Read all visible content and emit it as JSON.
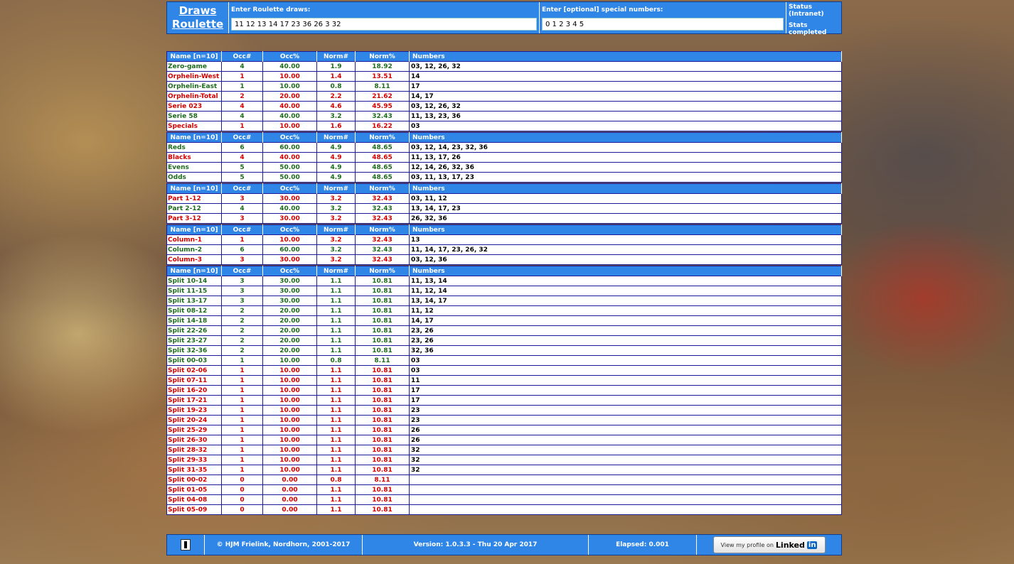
{
  "app": {
    "title_line1": "Draws",
    "title_line2": "Roulette"
  },
  "draws": {
    "label": "Enter Roulette draws:",
    "value": "11 12 13 14 17 23 36 26 3 32"
  },
  "specials": {
    "label": "Enter [optional] special numbers:",
    "value": "0 1 2 3 4 5"
  },
  "status": {
    "label": "Status (Intranet)",
    "value": "Stats completed"
  },
  "columns": {
    "name": "Name [n=10]",
    "occ": "Occ#",
    "occp": "Occ%",
    "normn": "Norm#",
    "normp": "Norm%",
    "numbers": "Numbers"
  },
  "colors": {
    "header_blue": "#2f86e6",
    "good_green": "#1d6b1d",
    "bad_red": "#d40000"
  },
  "groups": [
    [
      {
        "name": "Zero-game",
        "occ": "4",
        "occp": "40.00",
        "normn": "1.9",
        "normp": "18.92",
        "numbers": "03, 12, 26, 32",
        "c": "g"
      },
      {
        "name": "Orphelin-West",
        "occ": "1",
        "occp": "10.00",
        "normn": "1.4",
        "normp": "13.51",
        "numbers": "14",
        "c": "r"
      },
      {
        "name": "Orphelin-East",
        "occ": "1",
        "occp": "10.00",
        "normn": "0.8",
        "normp": "8.11",
        "numbers": "17",
        "c": "g"
      },
      {
        "name": "Orphelin-Total",
        "occ": "2",
        "occp": "20.00",
        "normn": "2.2",
        "normp": "21.62",
        "numbers": "14, 17",
        "c": "r"
      },
      {
        "name": "Serie 023",
        "occ": "4",
        "occp": "40.00",
        "normn": "4.6",
        "normp": "45.95",
        "numbers": "03, 12, 26, 32",
        "c": "r"
      },
      {
        "name": "Serie 58",
        "occ": "4",
        "occp": "40.00",
        "normn": "3.2",
        "normp": "32.43",
        "numbers": "11, 13, 23, 36",
        "c": "g"
      },
      {
        "name": "Specials",
        "occ": "1",
        "occp": "10.00",
        "normn": "1.6",
        "normp": "16.22",
        "numbers": "03",
        "c": "r"
      }
    ],
    [
      {
        "name": "Reds",
        "occ": "6",
        "occp": "60.00",
        "normn": "4.9",
        "normp": "48.65",
        "numbers": "03, 12, 14, 23, 32, 36",
        "c": "g"
      },
      {
        "name": "Blacks",
        "occ": "4",
        "occp": "40.00",
        "normn": "4.9",
        "normp": "48.65",
        "numbers": "11, 13, 17, 26",
        "c": "r"
      },
      {
        "name": "Evens",
        "occ": "5",
        "occp": "50.00",
        "normn": "4.9",
        "normp": "48.65",
        "numbers": "12, 14, 26, 32, 36",
        "c": "g"
      },
      {
        "name": "Odds",
        "occ": "5",
        "occp": "50.00",
        "normn": "4.9",
        "normp": "48.65",
        "numbers": "03, 11, 13, 17, 23",
        "c": "g"
      }
    ],
    [
      {
        "name": "Part 1-12",
        "occ": "3",
        "occp": "30.00",
        "normn": "3.2",
        "normp": "32.43",
        "numbers": "03, 11, 12",
        "c": "r"
      },
      {
        "name": "Part 2-12",
        "occ": "4",
        "occp": "40.00",
        "normn": "3.2",
        "normp": "32.43",
        "numbers": "13, 14, 17, 23",
        "c": "g"
      },
      {
        "name": "Part 3-12",
        "occ": "3",
        "occp": "30.00",
        "normn": "3.2",
        "normp": "32.43",
        "numbers": "26, 32, 36",
        "c": "r"
      }
    ],
    [
      {
        "name": "Column-1",
        "occ": "1",
        "occp": "10.00",
        "normn": "3.2",
        "normp": "32.43",
        "numbers": "13",
        "c": "r"
      },
      {
        "name": "Column-2",
        "occ": "6",
        "occp": "60.00",
        "normn": "3.2",
        "normp": "32.43",
        "numbers": "11, 14, 17, 23, 26, 32",
        "c": "g"
      },
      {
        "name": "Column-3",
        "occ": "3",
        "occp": "30.00",
        "normn": "3.2",
        "normp": "32.43",
        "numbers": "03, 12, 36",
        "c": "r"
      }
    ],
    [
      {
        "name": "Split 10-14",
        "occ": "3",
        "occp": "30.00",
        "normn": "1.1",
        "normp": "10.81",
        "numbers": "11, 13, 14",
        "c": "g"
      },
      {
        "name": "Split 11-15",
        "occ": "3",
        "occp": "30.00",
        "normn": "1.1",
        "normp": "10.81",
        "numbers": "11, 12, 14",
        "c": "g"
      },
      {
        "name": "Split 13-17",
        "occ": "3",
        "occp": "30.00",
        "normn": "1.1",
        "normp": "10.81",
        "numbers": "13, 14, 17",
        "c": "g"
      },
      {
        "name": "Split 08-12",
        "occ": "2",
        "occp": "20.00",
        "normn": "1.1",
        "normp": "10.81",
        "numbers": "11, 12",
        "c": "g"
      },
      {
        "name": "Split 14-18",
        "occ": "2",
        "occp": "20.00",
        "normn": "1.1",
        "normp": "10.81",
        "numbers": "14, 17",
        "c": "g"
      },
      {
        "name": "Split 22-26",
        "occ": "2",
        "occp": "20.00",
        "normn": "1.1",
        "normp": "10.81",
        "numbers": "23, 26",
        "c": "g"
      },
      {
        "name": "Split 23-27",
        "occ": "2",
        "occp": "20.00",
        "normn": "1.1",
        "normp": "10.81",
        "numbers": "23, 26",
        "c": "g"
      },
      {
        "name": "Split 32-36",
        "occ": "2",
        "occp": "20.00",
        "normn": "1.1",
        "normp": "10.81",
        "numbers": "32, 36",
        "c": "g"
      },
      {
        "name": "Split 00-03",
        "occ": "1",
        "occp": "10.00",
        "normn": "0.8",
        "normp": "8.11",
        "numbers": "03",
        "c": "g"
      },
      {
        "name": "Split 02-06",
        "occ": "1",
        "occp": "10.00",
        "normn": "1.1",
        "normp": "10.81",
        "numbers": "03",
        "c": "r"
      },
      {
        "name": "Split 07-11",
        "occ": "1",
        "occp": "10.00",
        "normn": "1.1",
        "normp": "10.81",
        "numbers": "11",
        "c": "r"
      },
      {
        "name": "Split 16-20",
        "occ": "1",
        "occp": "10.00",
        "normn": "1.1",
        "normp": "10.81",
        "numbers": "17",
        "c": "r"
      },
      {
        "name": "Split 17-21",
        "occ": "1",
        "occp": "10.00",
        "normn": "1.1",
        "normp": "10.81",
        "numbers": "17",
        "c": "r"
      },
      {
        "name": "Split 19-23",
        "occ": "1",
        "occp": "10.00",
        "normn": "1.1",
        "normp": "10.81",
        "numbers": "23",
        "c": "r"
      },
      {
        "name": "Split 20-24",
        "occ": "1",
        "occp": "10.00",
        "normn": "1.1",
        "normp": "10.81",
        "numbers": "23",
        "c": "r"
      },
      {
        "name": "Split 25-29",
        "occ": "1",
        "occp": "10.00",
        "normn": "1.1",
        "normp": "10.81",
        "numbers": "26",
        "c": "r"
      },
      {
        "name": "Split 26-30",
        "occ": "1",
        "occp": "10.00",
        "normn": "1.1",
        "normp": "10.81",
        "numbers": "26",
        "c": "r"
      },
      {
        "name": "Split 28-32",
        "occ": "1",
        "occp": "10.00",
        "normn": "1.1",
        "normp": "10.81",
        "numbers": "32",
        "c": "r"
      },
      {
        "name": "Split 29-33",
        "occ": "1",
        "occp": "10.00",
        "normn": "1.1",
        "normp": "10.81",
        "numbers": "32",
        "c": "r"
      },
      {
        "name": "Split 31-35",
        "occ": "1",
        "occp": "10.00",
        "normn": "1.1",
        "normp": "10.81",
        "numbers": "32",
        "c": "r"
      },
      {
        "name": "Split 00-02",
        "occ": "0",
        "occp": "0.00",
        "normn": "0.8",
        "normp": "8.11",
        "numbers": "",
        "c": "r"
      },
      {
        "name": "Split 01-05",
        "occ": "0",
        "occp": "0.00",
        "normn": "1.1",
        "normp": "10.81",
        "numbers": "",
        "c": "r"
      },
      {
        "name": "Split 04-08",
        "occ": "0",
        "occp": "0.00",
        "normn": "1.1",
        "normp": "10.81",
        "numbers": "",
        "c": "r"
      },
      {
        "name": "Split 05-09",
        "occ": "0",
        "occp": "0.00",
        "normn": "1.1",
        "normp": "10.81",
        "numbers": "",
        "c": "r"
      }
    ]
  ],
  "footer": {
    "info_icon": "info-icon",
    "copyright": "© HJM Frielink, Nordhorn, 2001-2017",
    "version": "Version: 1.0.3.3 - Thu 20 Apr 2017",
    "elapsed": "Elapsed: 0.001",
    "linkedin_text": "View my profile on",
    "linkedin_brand": "Linked",
    "linkedin_in": "in"
  }
}
